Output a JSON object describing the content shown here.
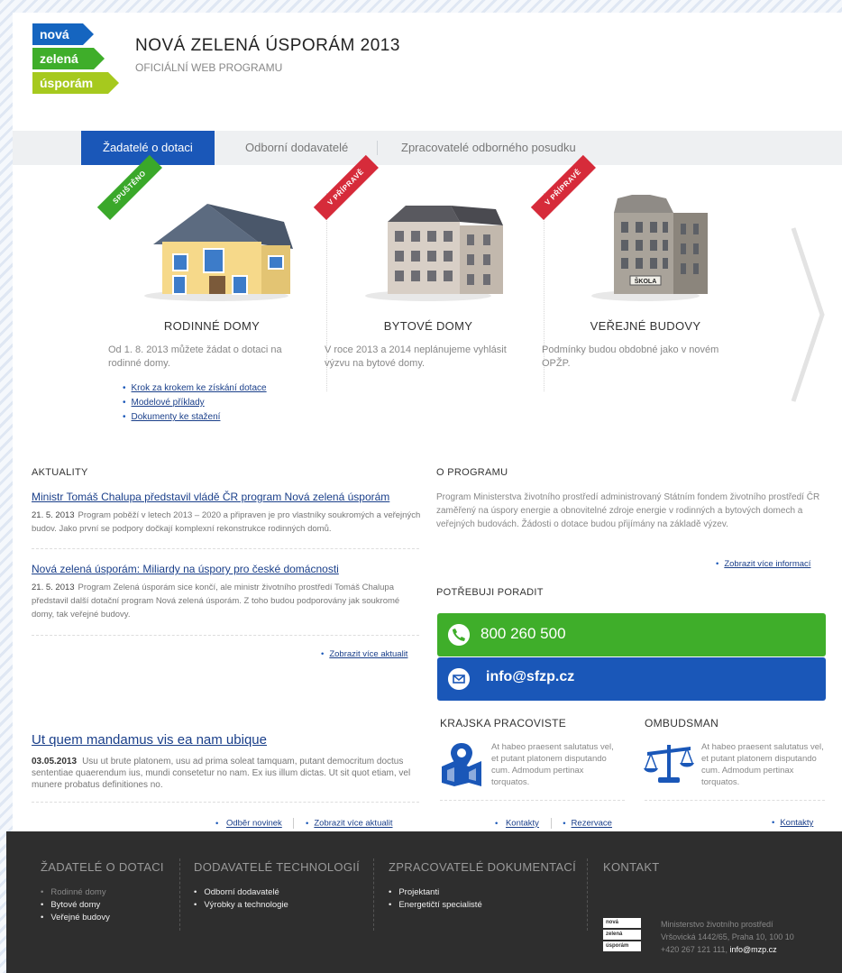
{
  "logo": {
    "line1": "nová",
    "line2": "zelená",
    "line3": "úsporám"
  },
  "header": {
    "title": "NOVÁ ZELENÁ ÚSPORÁM 2013",
    "subtitle": "OFICIÁLNÍ WEB PROGRAMU"
  },
  "nav": {
    "tabs": [
      {
        "label": "Žadatelé o dotaci",
        "active": true
      },
      {
        "label": "Odborní dodavatelé"
      },
      {
        "label": "Zpracovatelé odborného posudku"
      }
    ]
  },
  "programs": [
    {
      "badge": "SPUŠTĚNO",
      "title": "RODINNÉ DOMY",
      "text": "Od 1. 8. 2013 můžete žádat o dotaci na rodinné domy.",
      "links": [
        "Krok za krokem ke získání dotace",
        "Modelové příklady",
        "Dokumenty ke stažení"
      ]
    },
    {
      "badge": "V PŘÍPRAVĚ",
      "title": "BYTOVÉ DOMY",
      "text": "V roce 2013 a 2014 neplánujeme vyhlásit výzvu na bytové domy."
    },
    {
      "badge": "V PŘÍPRAVĚ",
      "title": "VEŘEJNÉ BUDOVY",
      "text": "Podmínky budou obdobné jako v novém OPŽP.",
      "sign": "ŠKOLA"
    }
  ],
  "news": {
    "heading": "AKTUALITY",
    "items": [
      {
        "title": "Ministr Tomáš Chalupa představil vládě ČR program Nová zelená úsporám",
        "date": "21. 5. 2013",
        "text": "Program poběží v letech 2013 – 2020 a připraven je pro vlastníky soukromých a veřejných budov. Jako první se podpory dočkají komplexní rekonstrukce rodinných domů."
      },
      {
        "title": "Nová zelená úsporám: Miliardy na úspory pro české domácnosti",
        "date": "21. 5. 2013",
        "text": "Program Zelená úsporám sice končí, ale ministr životního prostředí Tomáš Chalupa představil další dotační program Nová zelená úsporám. Z toho budou podporovány jak soukromé domy, tak veřejné budovy."
      }
    ],
    "more": "Zobrazit více aktualit"
  },
  "about": {
    "heading": "O PROGRAMU",
    "text": "Program Ministerstva životního prostředí administrovaný Státním fondem životního prostředí ČR zaměřený na úspory energie a obnovitelné zdroje energie v rodinných a bytových domech a veřejných budovách. Žádosti o dotace budou přijímány na základě výzev.",
    "more": "Zobrazit více informací"
  },
  "help": {
    "heading": "POTŘEBUJI PORADIT",
    "phone": "800 260 500",
    "email": "info@sfzp.cz",
    "phone_color": "#3fae2a",
    "email_color": "#1a57b8"
  },
  "old_news": {
    "title": "Ut quem mandamus vis ea nam ubique",
    "date": "03.05.2013",
    "text": "Usu ut brute platonem, usu ad prima soleat tamquam, putant democritum doctus sententiae quaerendum ius, mundi consetetur no nam. Ex ius illum dictas. Ut sit quot etiam, vel munere probatus definitiones no.",
    "link1": "Odběr novinek",
    "link2": "Zobrazit více aktualit"
  },
  "krajska": {
    "heading": "KRAJSKA PRACOVISTE",
    "text": "At habeo praesent salutatus vel, et putant platonem disputando cum. Admodum pertinax torquatos.",
    "link1": "Kontakty",
    "link2": "Rezervace"
  },
  "ombudsman": {
    "heading": "OMBUDSMAN",
    "text": "At habeo praesent salutatus vel, et putant platonem disputando cum. Admodum pertinax torquatos.",
    "link": "Kontakty"
  },
  "footer": {
    "cols": [
      {
        "heading": "ŽADATELÉ O DOTACI",
        "items": [
          "Rodinné domy",
          "Bytové domy",
          "Veřejné budovy"
        ]
      },
      {
        "heading": "DODAVATELÉ TECHNOLOGIÍ",
        "items": [
          "Odborní dodavatelé",
          "Výrobky a technologie"
        ]
      },
      {
        "heading": "ZPRACOVATELÉ DOKUMENTACÍ",
        "items": [
          "Projektanti",
          "Energetičtí specialisté"
        ]
      }
    ],
    "contact": {
      "heading": "KONTAKT",
      "line1": "Ministerstvo životního prostředí",
      "line2": "Vršovická 1442/65, Praha 10, 100 10",
      "phone": "+420 267 121 111,",
      "email": "info@mzp.cz"
    },
    "logo": {
      "line1": "nová",
      "line2": "zelená",
      "line3": "úsporám"
    }
  }
}
